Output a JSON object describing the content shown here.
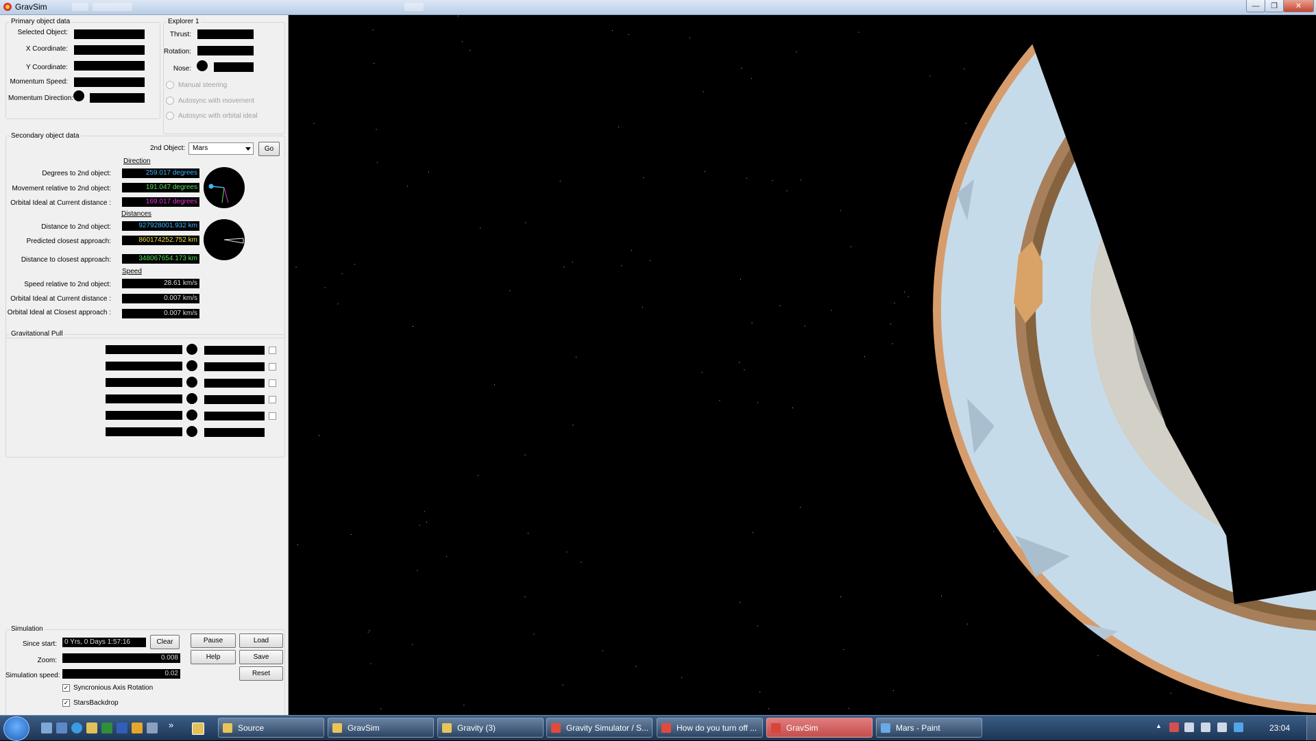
{
  "window": {
    "title": "GravSim",
    "min": "—",
    "max": "❐",
    "close": "✕"
  },
  "primary": {
    "group_title": "Primary object data",
    "selected_object_label": "Selected Object:",
    "x_label": "X Coordinate:",
    "y_label": "Y Coordinate:",
    "momentum_speed_label": "Momentum Speed:",
    "momentum_direction_label": "Momentum Direction:"
  },
  "explorer": {
    "group_title": "Explorer 1",
    "thrust_label": "Thrust:",
    "rotation_label": "Rotation:",
    "nose_label": "Nose:",
    "radio_manual": "Manual steering",
    "radio_autosync_movement": "Autosync with movement",
    "radio_autosync_orbital": "Autosync with orbital ideal"
  },
  "secondary": {
    "group_title": "Secondary object data",
    "second_object_label": "2nd Object:",
    "second_object_value": "Mars",
    "go_button": "Go",
    "direction_header": "Direction",
    "degrees_label": "Degrees to 2nd object:",
    "degrees_value": "259.017 degrees",
    "movement_label": "Movement relative to 2nd object:",
    "movement_value": "191.047 degrees",
    "orbital_ideal_current_label": "Orbital Ideal at Current distance :",
    "orbital_ideal_current_value": "169.017 degrees",
    "distances_header": "Distances",
    "distance_label": "Distance to 2nd object:",
    "distance_value": "927928001.932 km",
    "predicted_label": "Predicted closest approach:",
    "predicted_value": "860174252.752 km",
    "distance_closest_label": "Distance to closest approach:",
    "distance_closest_value": "348067654.173 km",
    "speed_header": "Speed",
    "speed_relative_label": "Speed relative to 2nd object:",
    "speed_relative_value": "28.61 km/s",
    "orbital_speed_current_label": "Orbital Ideal at Current distance :",
    "orbital_speed_current_value": "0.007 km/s",
    "orbital_speed_closest_label": "Orbital Ideal at Closest approach :",
    "orbital_speed_closest_value": "0.007 km/s",
    "value_colors": {
      "degrees": "#3fb6ff",
      "movement": "#59e35a",
      "orbital": "#e03ad6",
      "distance": "#3fb6ff",
      "predicted": "#f0e040",
      "closest": "#59e35a",
      "white": "#e8e8e8"
    }
  },
  "grav": {
    "group_title": "Gravitational Pull",
    "row_count": 6
  },
  "simulation": {
    "group_title": "Simulation",
    "since_start_label": "Since start:",
    "since_start_value": "0 Yrs, 0 Days 1:57:16",
    "zoom_label": "Zoom:",
    "zoom_value": "0.008",
    "sim_speed_label": "Simulation speed:",
    "sim_speed_value": "0.02",
    "clear_button": "Clear",
    "pause_button": "Pause",
    "load_button": "Load",
    "help_button": "Help",
    "save_button": "Save",
    "reset_button": "Reset",
    "sync_axis_label": "Syncronious Axis Rotation",
    "stars_backdrop_label": "StarsBackdrop",
    "check_mark": "✓"
  },
  "taskbar": {
    "tasks": [
      {
        "label": "Source",
        "icon_color": "#e8c45a"
      },
      {
        "label": "GravSim",
        "icon_color": "#e8c45a"
      },
      {
        "label": "Gravity (3)",
        "icon_color": "#e8c45a"
      },
      {
        "label": "Gravity Simulator / S...",
        "icon_color": "#e24b3b"
      },
      {
        "label": "How do you turn off ...",
        "icon_color": "#e24b3b"
      },
      {
        "label": "GravSim",
        "icon_color": "#d6453b"
      },
      {
        "label": "Mars - Paint",
        "icon_color": "#6aa8e6"
      }
    ],
    "clock": "23:04",
    "overflow": "»",
    "tray_arrow": "▲"
  }
}
